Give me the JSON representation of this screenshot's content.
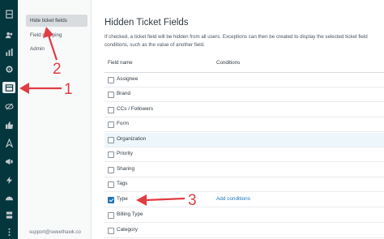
{
  "rail": {
    "icons": [
      "home-icon",
      "users-icon",
      "reporting-icon",
      "settings-icon",
      "app-icon",
      "eye-slash-icon",
      "thumbs-up-icon",
      "compass-icon",
      "megaphone-icon",
      "lightning-icon",
      "dashboard-icon",
      "server-icon",
      "more-icon"
    ],
    "active_icon": "app-icon"
  },
  "subnav": {
    "items": [
      {
        "label": "Hide ticket fields",
        "active": true
      },
      {
        "label": "Field mapping",
        "active": false
      },
      {
        "label": "Admin",
        "active": false
      }
    ],
    "support": "support@sweethawk.co"
  },
  "main": {
    "title": "Hidden Ticket Fields",
    "desc_line1": "If checked, a ticket field will be hidden from all users. Exceptions can then be created to display the selected ticket field",
    "desc_line2": "conditions, such as the value of another field.",
    "col_field": "Field name",
    "col_conditions": "Conditions",
    "fields": [
      {
        "label": "Assignee",
        "checked": false
      },
      {
        "label": "Brand",
        "checked": false
      },
      {
        "label": "CCs / Followers",
        "checked": false
      },
      {
        "label": "Form",
        "checked": false
      },
      {
        "label": "Organization",
        "checked": false,
        "highlighted": true
      },
      {
        "label": "Priority",
        "checked": false
      },
      {
        "label": "Sharing",
        "checked": false
      },
      {
        "label": "Tags",
        "checked": false
      },
      {
        "label": "Type",
        "checked": true,
        "action": "Add conditions"
      },
      {
        "label": "Billing Type",
        "checked": false
      },
      {
        "label": "Category",
        "checked": false
      }
    ]
  },
  "annotations": {
    "num1": "1",
    "num2": "2",
    "num3": "3",
    "color": "#e23c43"
  }
}
